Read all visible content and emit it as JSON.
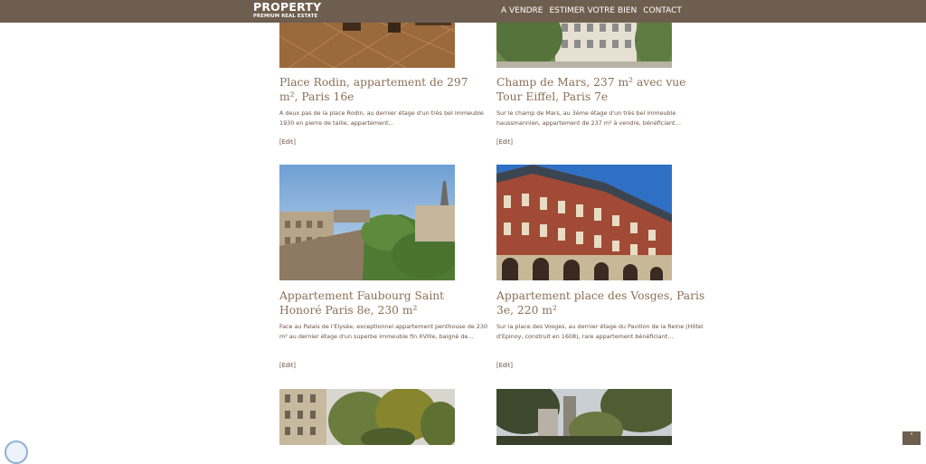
{
  "header": {
    "logo_main": "PROPERTY",
    "logo_sub": "PREMIUM REAL ESTATE",
    "nav": [
      "A VENDRE",
      "ESTIMER VOTRE BIEN",
      "CONTACT"
    ]
  },
  "listings": [
    {
      "title": "Place Rodin, appartement de 297 m², Paris 16e",
      "desc": "A deux pas de la place Rodin, au dernier étage d'un très bel immeuble 1930 en pierre de taille, appartement…",
      "edit": "[Edit]"
    },
    {
      "title": "Champ de Mars, 237 m² avec vue Tour Eiffel, Paris 7e",
      "desc": "Sur le champ de Mars, au 3ème étage d'un très bel immeuble haussmannien, appartement de 237 m² à vendre, bénéficiant…",
      "edit": "[Edit]"
    },
    {
      "title": "Appartement Faubourg Saint Honoré Paris 8e, 230 m²",
      "desc": "Face au Palais de l'Elysée, exceptionnel appartement penthouse de 230 m² au dernier étage d'un superbe immeuble fin XVIIIe, baigné de…",
      "edit": "[Edit]"
    },
    {
      "title": "Appartement place des Vosges, Paris 3e, 220 m²",
      "desc": "Sur la place des Vosges, au dernier étage du Pavillon de la Reine (Hôtel d'Epinoy, construit en 1608), rare appartement bénéficiant…",
      "edit": "[Edit]"
    }
  ],
  "back_to_top": "˄",
  "colors": {
    "header_bg": "#6e5e4f",
    "title": "#8a6f56",
    "text": "#6a5040"
  }
}
